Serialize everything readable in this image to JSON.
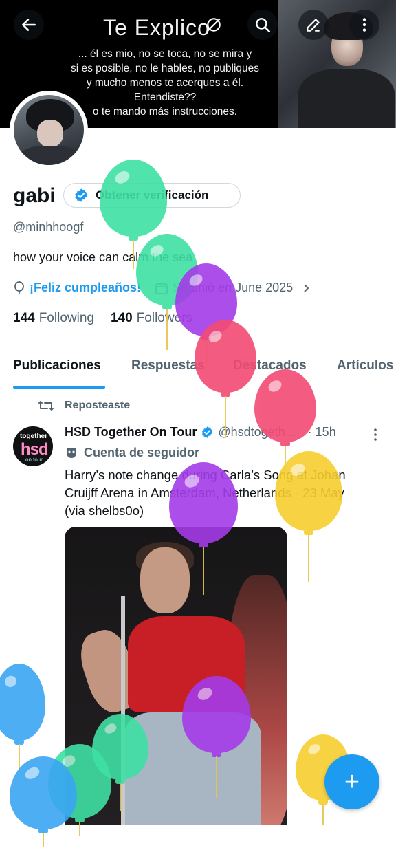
{
  "banner": {
    "title": "Te Explico",
    "lines": [
      "... él es mio, no se toca, no se mira y",
      "si es posible, no le hables, no publiques",
      "y mucho menos te acerques a él.",
      "Entendiste??",
      "o te mando más instrucciones."
    ]
  },
  "topbar": {
    "icons": [
      "back-arrow-icon",
      "search-icon",
      "compose-icon",
      "more-vertical-icon"
    ]
  },
  "profile": {
    "name": "gabi",
    "verification_button": "Obtener verificación",
    "handle": "@minhhoogf",
    "bio": "how your voice can calm the sea",
    "birthday_text": "¡Feliz cumpleaños!",
    "joined": "Se unió en June 2025",
    "following_count": "144",
    "following_label": "Following",
    "followers_count": "140",
    "followers_label": "Followers"
  },
  "tabs": [
    {
      "label": "Publicaciones",
      "active": true
    },
    {
      "label": "Respuestas",
      "active": false
    },
    {
      "label": "Destacados",
      "active": false
    },
    {
      "label": "Artículos",
      "active": false
    }
  ],
  "post": {
    "repost_label": "Reposteaste",
    "avatar_text": {
      "top": "together",
      "middle": "hsd",
      "bottom": "on tour"
    },
    "author_name": "HSD Together On Tour",
    "author_handle": "@hsdtogeth...",
    "time": "· 15h",
    "account_label": "Cuenta de seguidor",
    "text_lines": [
      "Harry’s note change during Carla’s Song at Johan",
      "Cruijff Arena in Amsterdam, Netherlands - 23 May",
      "(via shelbs0o)"
    ]
  },
  "fab": {
    "label": "+"
  },
  "colors": {
    "accent": "#1d9bf0",
    "text": "#0f1419",
    "muted": "#536471",
    "balloon_green": "#3fe0a4",
    "balloon_purple": "#a43be8",
    "balloon_pink": "#f24b73",
    "balloon_yellow": "#f7cf2f",
    "balloon_blue": "#3aa6f2"
  }
}
